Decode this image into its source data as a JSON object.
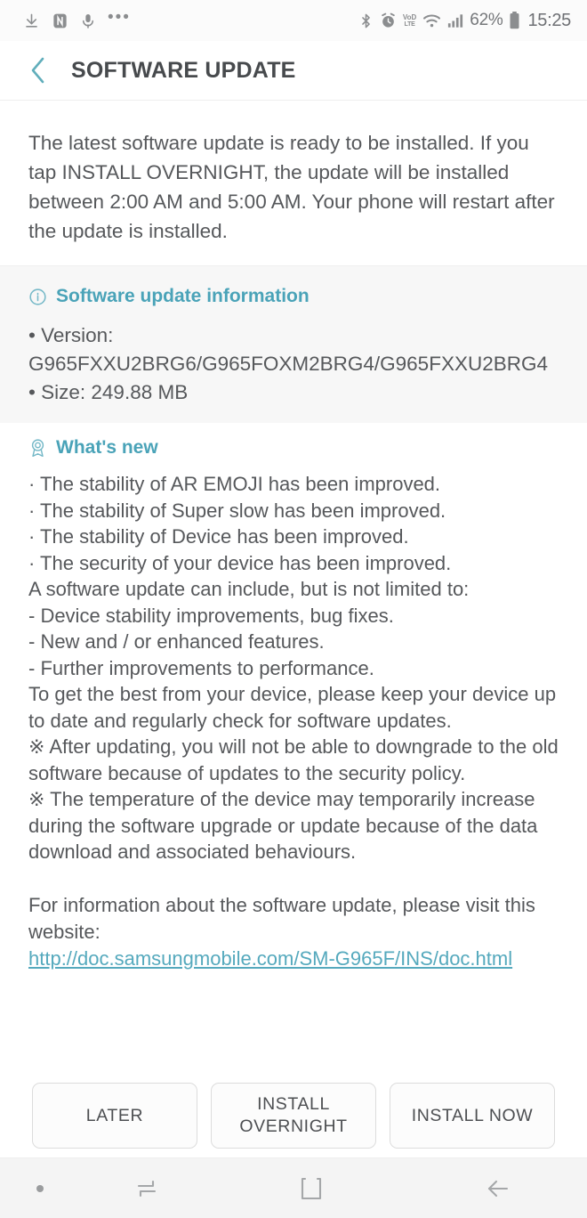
{
  "status_bar": {
    "left_icons": [
      {
        "name": "download-icon",
        "label": "download"
      },
      {
        "name": "app-notification-icon",
        "label": "app notification"
      },
      {
        "name": "microphone-icon",
        "label": "microphone"
      },
      {
        "name": "more-notifications-icon",
        "label": "•••"
      }
    ],
    "right_icons": [
      {
        "name": "bluetooth-icon",
        "label": "bluetooth"
      },
      {
        "name": "alarm-icon",
        "label": "alarm"
      },
      {
        "name": "volte-icon",
        "label_top": "VoD",
        "label_bottom": "LTE"
      },
      {
        "name": "wifi-icon",
        "label": "wifi"
      },
      {
        "name": "signal-icon",
        "label": "signal"
      }
    ],
    "battery_percent": "62%",
    "clock": "15:25"
  },
  "title_bar": {
    "back_label": "Back",
    "title": "SOFTWARE UPDATE"
  },
  "intro": {
    "text": "The latest software update is ready to be installed. If you tap INSTALL OVERNIGHT, the update will be installed between 2:00 AM and 5:00 AM. Your phone will restart after the update is installed."
  },
  "update_info": {
    "heading": "Software update information",
    "icon": "info-circle-icon",
    "version_line": "• Version: G965FXXU2BRG6/G965FOXM2BRG4/G965FXXU2BRG4",
    "size_line": "• Size: 249.88 MB"
  },
  "whats_new": {
    "heading": "What's new",
    "icon": "badge-icon",
    "lines": [
      "· The stability of AR EMOJI has been improved.",
      "· The stability of Super slow has been improved.",
      "· The stability of Device has been improved.",
      "· The security of your device has been improved.",
      "A software update can include, but is not limited to:",
      " - Device stability improvements, bug fixes.",
      " - New and / or enhanced features.",
      " - Further improvements to performance.",
      "To get the best from your device, please keep your device up to date and regularly check for software updates.",
      "※ After updating, you will not be able to downgrade to the old software because of updates to the security policy.",
      "※ The temperature of the device may temporarily increase during the software upgrade or update because of the data download and associated behaviours."
    ]
  },
  "website": {
    "intro": "For information about the software update, please visit this website:",
    "url": "http://doc.samsungmobile.com/SM-G965F/INS/doc.html",
    "url_color": "#55a9bd"
  },
  "buttons": {
    "later": "LATER",
    "install_overnight": "INSTALL OVERNIGHT",
    "install_now": "INSTALL NOW"
  },
  "nav_bar": {
    "dot": "•",
    "recents": "recents-icon",
    "home": "home-icon",
    "back": "back-icon"
  },
  "colors": {
    "accent": "#4aa3b8",
    "text": "#56585b",
    "title": "#474a4d",
    "section_bg": "#f7f7f7",
    "nav_bg": "#f4f4f4"
  }
}
